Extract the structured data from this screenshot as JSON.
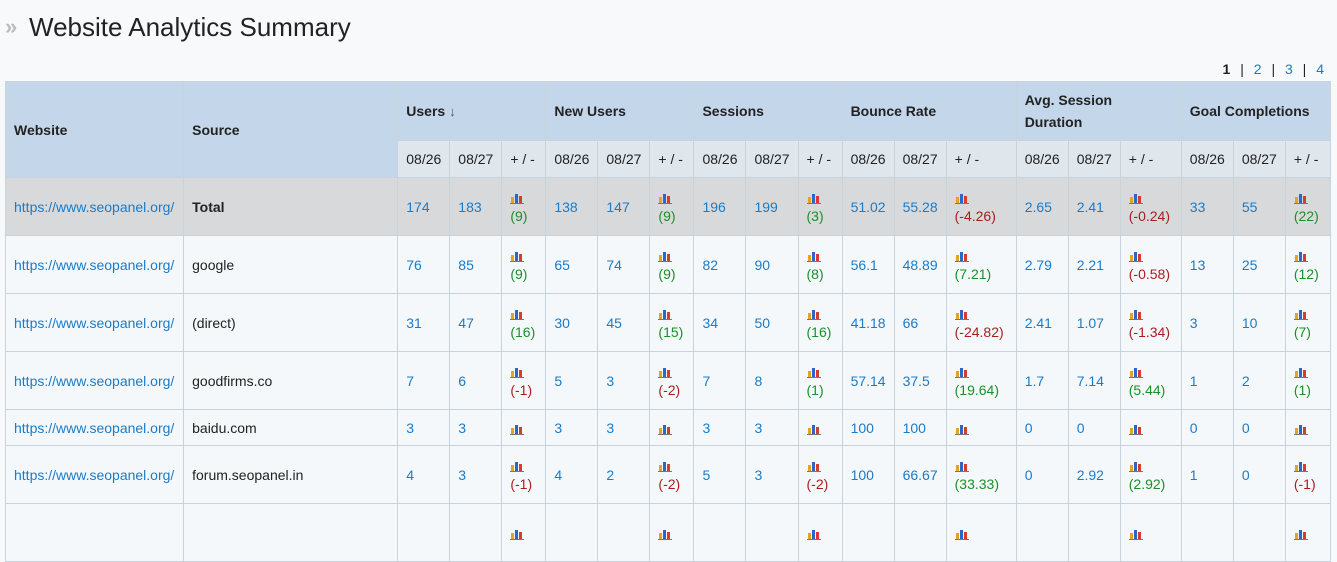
{
  "page": {
    "title": "Website Analytics Summary"
  },
  "pagination": {
    "current": "1",
    "pages": [
      "2",
      "3",
      "4"
    ],
    "separator": "|"
  },
  "table": {
    "headers": {
      "website": "Website",
      "source": "Source",
      "groups": [
        "Users",
        "New Users",
        "Sessions",
        "Bounce Rate",
        "Avg. Session Duration",
        "Goal Completions"
      ],
      "date1": "08/26",
      "date2": "08/27",
      "diff": "+ / -"
    },
    "rows": [
      {
        "website": "https://www.seopanel.org/",
        "source": "Total",
        "cells": [
          [
            "174",
            "183",
            "(9)",
            "pos"
          ],
          [
            "138",
            "147",
            "(9)",
            "pos"
          ],
          [
            "196",
            "199",
            "(3)",
            "pos"
          ],
          [
            "51.02",
            "55.28",
            "(-4.26)",
            "neg"
          ],
          [
            "2.65",
            "2.41",
            "(-0.24)",
            "neg"
          ],
          [
            "33",
            "55",
            "(22)",
            "pos"
          ]
        ]
      },
      {
        "website": "https://www.seopanel.org/",
        "source": "google",
        "cells": [
          [
            "76",
            "85",
            "(9)",
            "pos"
          ],
          [
            "65",
            "74",
            "(9)",
            "pos"
          ],
          [
            "82",
            "90",
            "(8)",
            "pos"
          ],
          [
            "56.1",
            "48.89",
            "(7.21)",
            "pos"
          ],
          [
            "2.79",
            "2.21",
            "(-0.58)",
            "neg"
          ],
          [
            "13",
            "25",
            "(12)",
            "pos"
          ]
        ]
      },
      {
        "website": "https://www.seopanel.org/",
        "source": "(direct)",
        "cells": [
          [
            "31",
            "47",
            "(16)",
            "pos"
          ],
          [
            "30",
            "45",
            "(15)",
            "pos"
          ],
          [
            "34",
            "50",
            "(16)",
            "pos"
          ],
          [
            "41.18",
            "66",
            "(-24.82)",
            "neg"
          ],
          [
            "2.41",
            "1.07",
            "(-1.34)",
            "neg"
          ],
          [
            "3",
            "10",
            "(7)",
            "pos"
          ]
        ]
      },
      {
        "website": "https://www.seopanel.org/",
        "source": "goodfirms.co",
        "cells": [
          [
            "7",
            "6",
            "(-1)",
            "neg"
          ],
          [
            "5",
            "3",
            "(-2)",
            "neg"
          ],
          [
            "7",
            "8",
            "(1)",
            "pos"
          ],
          [
            "57.14",
            "37.5",
            "(19.64)",
            "pos"
          ],
          [
            "1.7",
            "7.14",
            "(5.44)",
            "pos"
          ],
          [
            "1",
            "2",
            "(1)",
            "pos"
          ]
        ]
      },
      {
        "website": "https://www.seopanel.org/",
        "source": "baidu.com",
        "cells": [
          [
            "3",
            "3",
            "",
            ""
          ],
          [
            "3",
            "3",
            "",
            ""
          ],
          [
            "3",
            "3",
            "",
            ""
          ],
          [
            "100",
            "100",
            "",
            ""
          ],
          [
            "0",
            "0",
            "",
            ""
          ],
          [
            "0",
            "0",
            "",
            ""
          ]
        ]
      },
      {
        "website": "https://www.seopanel.org/",
        "source": "forum.seopanel.in",
        "cells": [
          [
            "4",
            "3",
            "(-1)",
            "neg"
          ],
          [
            "4",
            "2",
            "(-2)",
            "neg"
          ],
          [
            "5",
            "3",
            "(-2)",
            "neg"
          ],
          [
            "100",
            "66.67",
            "(33.33)",
            "pos"
          ],
          [
            "0",
            "2.92",
            "(2.92)",
            "pos"
          ],
          [
            "1",
            "0",
            "(-1)",
            "neg"
          ]
        ]
      },
      {
        "website": "",
        "source": "",
        "cells": [
          [
            "",
            "",
            "",
            ""
          ],
          [
            "",
            "",
            "",
            ""
          ],
          [
            "",
            "",
            "",
            ""
          ],
          [
            "",
            "",
            "",
            ""
          ],
          [
            "",
            "",
            "",
            ""
          ],
          [
            "",
            "",
            "",
            ""
          ]
        ]
      }
    ]
  },
  "icons": {
    "chart": "bar-chart-icon",
    "sort": "sort-down-arrow-icon",
    "title_marker": "double-chevron-icon"
  },
  "colors": {
    "header_bg": "#c3d6ea",
    "subheader_bg": "#dfe6ec",
    "total_row_bg": "#d8d9db",
    "link": "#1a7bc9",
    "positive": "#1a8f2a",
    "negative": "#aa1d1d"
  }
}
